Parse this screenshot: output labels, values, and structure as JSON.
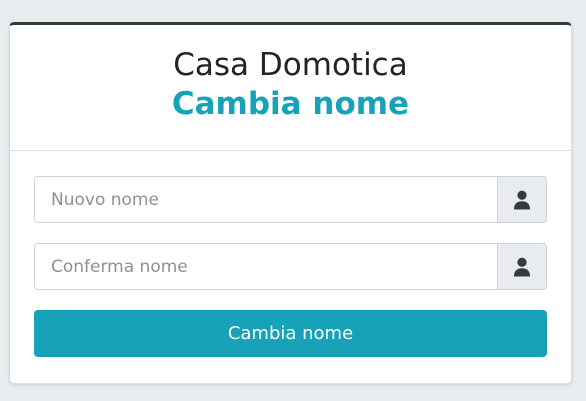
{
  "header": {
    "app_title": "Casa Domotica",
    "page_title": "Cambia nome"
  },
  "form": {
    "new_name": {
      "placeholder": "Nuovo nome",
      "value": "",
      "icon": "user-icon"
    },
    "confirm_name": {
      "placeholder": "Conferma nome",
      "value": "",
      "icon": "user-icon"
    },
    "submit_label": "Cambia nome"
  },
  "colors": {
    "accent": "#17a2b8",
    "top_border": "#343a40",
    "background": "#e9ecef"
  }
}
